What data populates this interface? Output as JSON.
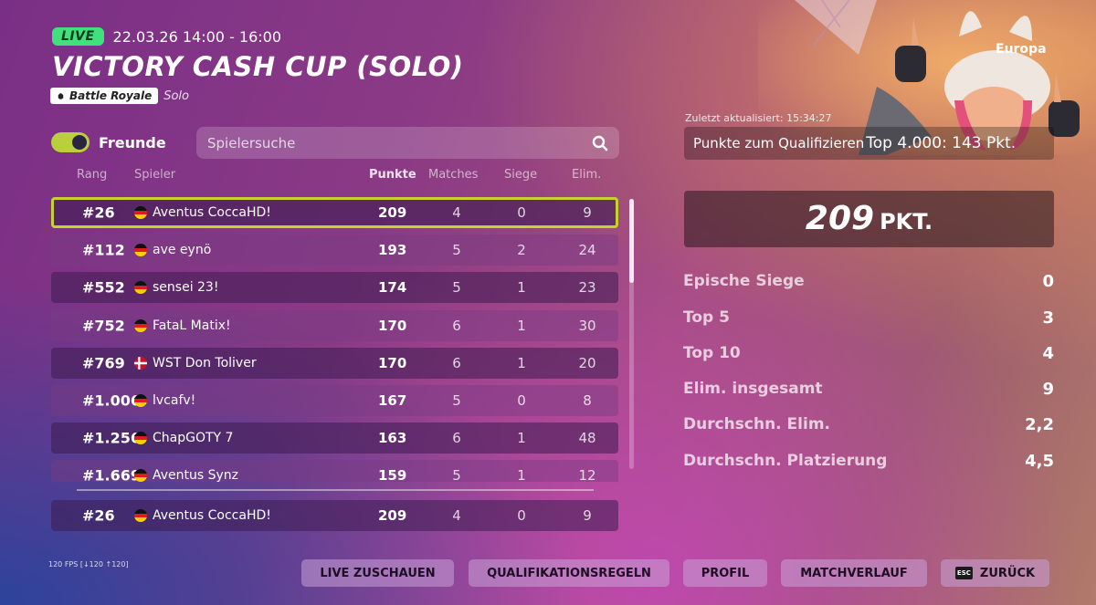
{
  "header": {
    "live_label": "LIVE",
    "date": "22.03.26 14:00 - 16:00",
    "title": "VICTORY CASH CUP (SOLO)",
    "mode": "Battle Royale",
    "mode_sub": "Solo"
  },
  "filters": {
    "friends_label": "Freunde",
    "friends_on": true,
    "search_placeholder": "Spielersuche"
  },
  "columns": {
    "rank": "Rang",
    "player": "Spieler",
    "points": "Punkte",
    "matches": "Matches",
    "wins": "Siege",
    "elims": "Elim."
  },
  "rows": [
    {
      "rank": "#26",
      "flag": "de",
      "player": "Aventus CoccaHD!",
      "points": "209",
      "matches": "4",
      "wins": "0",
      "elims": "9"
    },
    {
      "rank": "#112",
      "flag": "de",
      "player": "ave eynö",
      "points": "193",
      "matches": "5",
      "wins": "2",
      "elims": "24"
    },
    {
      "rank": "#552",
      "flag": "de",
      "player": "sensei 23!",
      "points": "174",
      "matches": "5",
      "wins": "1",
      "elims": "23"
    },
    {
      "rank": "#752",
      "flag": "de",
      "player": "FataL Matix!",
      "points": "170",
      "matches": "6",
      "wins": "1",
      "elims": "30"
    },
    {
      "rank": "#769",
      "flag": "dk",
      "player": "WST Don Toliver",
      "points": "170",
      "matches": "6",
      "wins": "1",
      "elims": "20"
    },
    {
      "rank": "#1.006",
      "flag": "de",
      "player": "lvcafv!",
      "points": "167",
      "matches": "5",
      "wins": "0",
      "elims": "8"
    },
    {
      "rank": "#1.256",
      "flag": "de",
      "player": "ChapGOTY 7",
      "points": "163",
      "matches": "6",
      "wins": "1",
      "elims": "48"
    },
    {
      "rank": "#1.669",
      "flag": "de",
      "player": "Aventus Synz",
      "points": "159",
      "matches": "5",
      "wins": "1",
      "elims": "12"
    }
  ],
  "own_row": {
    "rank": "#26",
    "flag": "de",
    "player": "Aventus CoccaHD!",
    "points": "209",
    "matches": "4",
    "wins": "0",
    "elims": "9"
  },
  "panel": {
    "region": "Europa",
    "updated": "Zuletzt aktualisiert: 15:34:27",
    "qualify_label": "Punkte zum Qualifizieren",
    "qualify_value": "Top 4.000: 143 Pkt.",
    "score_value": "209",
    "score_unit": "PKT.",
    "stats": [
      {
        "label": "Epische Siege",
        "value": "0"
      },
      {
        "label": "Top 5",
        "value": "3"
      },
      {
        "label": "Top 10",
        "value": "4"
      },
      {
        "label": "Elim. insgesamt",
        "value": "9"
      },
      {
        "label": "Durchschn. Elim.",
        "value": "2,2"
      },
      {
        "label": "Durchschn. Platzierung",
        "value": "4,5"
      }
    ]
  },
  "footer": {
    "fps": "120 FPS [↓120 ↑120]",
    "buttons": {
      "live": "LIVE ZUSCHAUEN",
      "rules": "QUALIFIKATIONSREGELN",
      "profile": "PROFIL",
      "history": "MATCHVERLAUF",
      "back": "ZURÜCK",
      "back_key": "ESC"
    }
  },
  "colors": {
    "live_badge": "#3fe07d",
    "selection_border": "#c7d32a",
    "toggle_on": "#b9cf3b"
  }
}
